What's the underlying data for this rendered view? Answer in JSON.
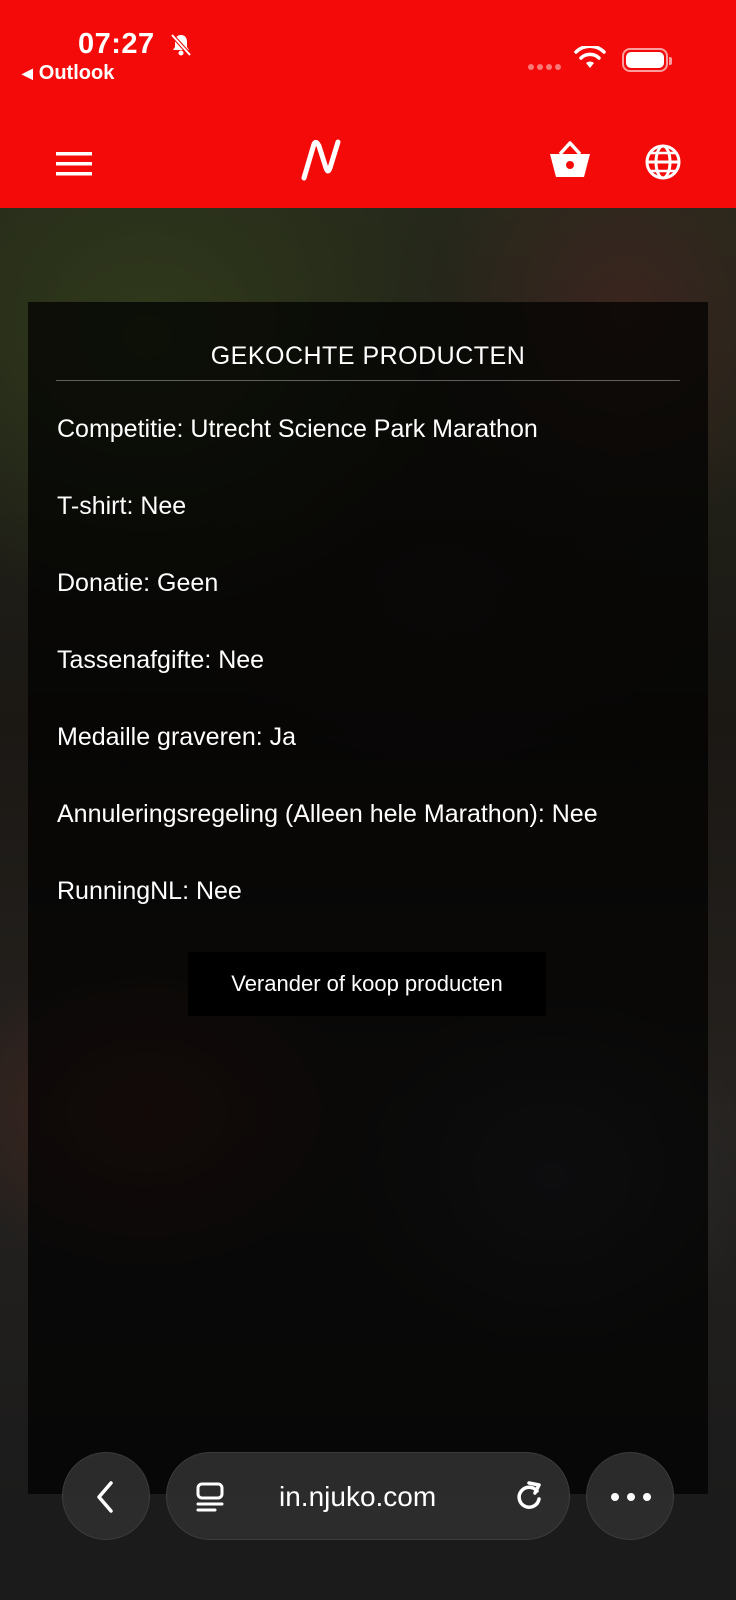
{
  "status_bar": {
    "time": "07:27",
    "back_app": "Outlook"
  },
  "app_bar": {
    "logo_icon": "njuko-logo-icon",
    "menu_icon": "hamburger-menu-icon",
    "basket_icon": "shopping-basket-icon",
    "language_icon": "globe-icon"
  },
  "panel": {
    "title": "GEKOCHTE PRODUCTEN",
    "items": [
      "Competitie: Utrecht Science Park Marathon",
      "T-shirt: Nee",
      "Donatie: Geen",
      "Tassenafgifte: Nee",
      "Medaille graveren: Ja",
      "Annuleringsregeling  (Alleen hele Marathon): Nee",
      "RunningNL: Nee"
    ],
    "change_button": "Verander of koop producten"
  },
  "browser": {
    "url": "in.njuko.com"
  },
  "colors": {
    "header_red": "#f50a0a",
    "panel_bg": "rgba(0,0,0,0.72)"
  }
}
